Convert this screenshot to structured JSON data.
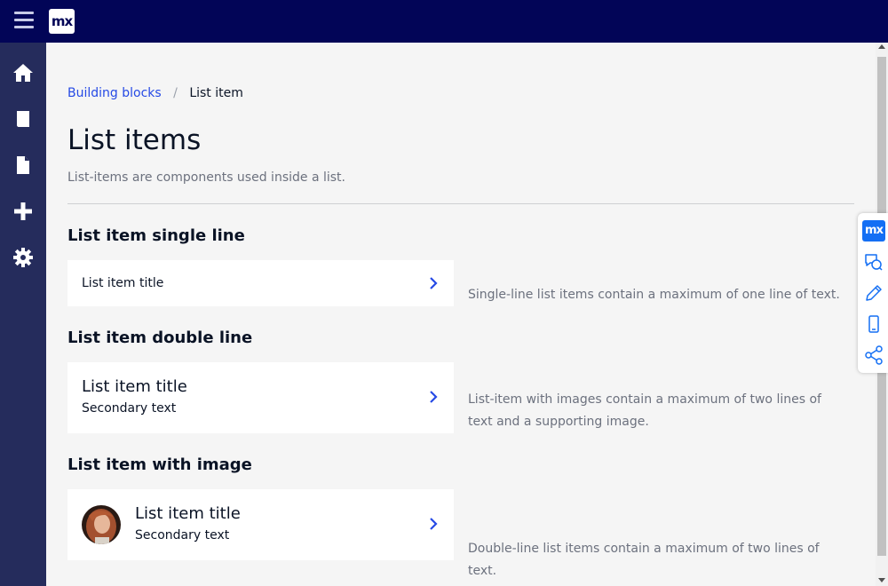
{
  "header": {
    "logo_text": "mx",
    "menu_icon": "hamburger-menu-icon"
  },
  "sidebar": {
    "items": [
      {
        "name": "home",
        "icon": "home-icon"
      },
      {
        "name": "book",
        "icon": "book-icon"
      },
      {
        "name": "document",
        "icon": "document-icon"
      },
      {
        "name": "add",
        "icon": "plus-icon"
      },
      {
        "name": "settings",
        "icon": "gear-icon"
      }
    ]
  },
  "breadcrumb": {
    "parent": "Building blocks",
    "separator": "/",
    "current": "List item"
  },
  "page": {
    "title": "List items",
    "subtitle": "List-items are components used inside a list."
  },
  "sections": [
    {
      "heading": "List item single line",
      "item": {
        "title": "List item title"
      },
      "description": "Single-line list items contain a maximum of one line of text."
    },
    {
      "heading": "List item double line",
      "item": {
        "title": "List item title",
        "secondary": "Secondary text"
      },
      "description": "List-item with images contain a maximum of two lines of text and a supporting image."
    },
    {
      "heading": "List item with image",
      "item": {
        "title": "List item title",
        "secondary": "Secondary text"
      },
      "description": "Double-line list items contain a maximum of two lines of text."
    }
  ],
  "dock": {
    "logo_text": "mx",
    "items": [
      "chat-icon",
      "pencil-icon",
      "mobile-icon",
      "share-icon"
    ]
  },
  "colors": {
    "topbar": "#020557",
    "sidebar": "#252c5c",
    "link": "#264ae5",
    "background": "#f5f5f5",
    "dock_logo": "#146ff4"
  }
}
